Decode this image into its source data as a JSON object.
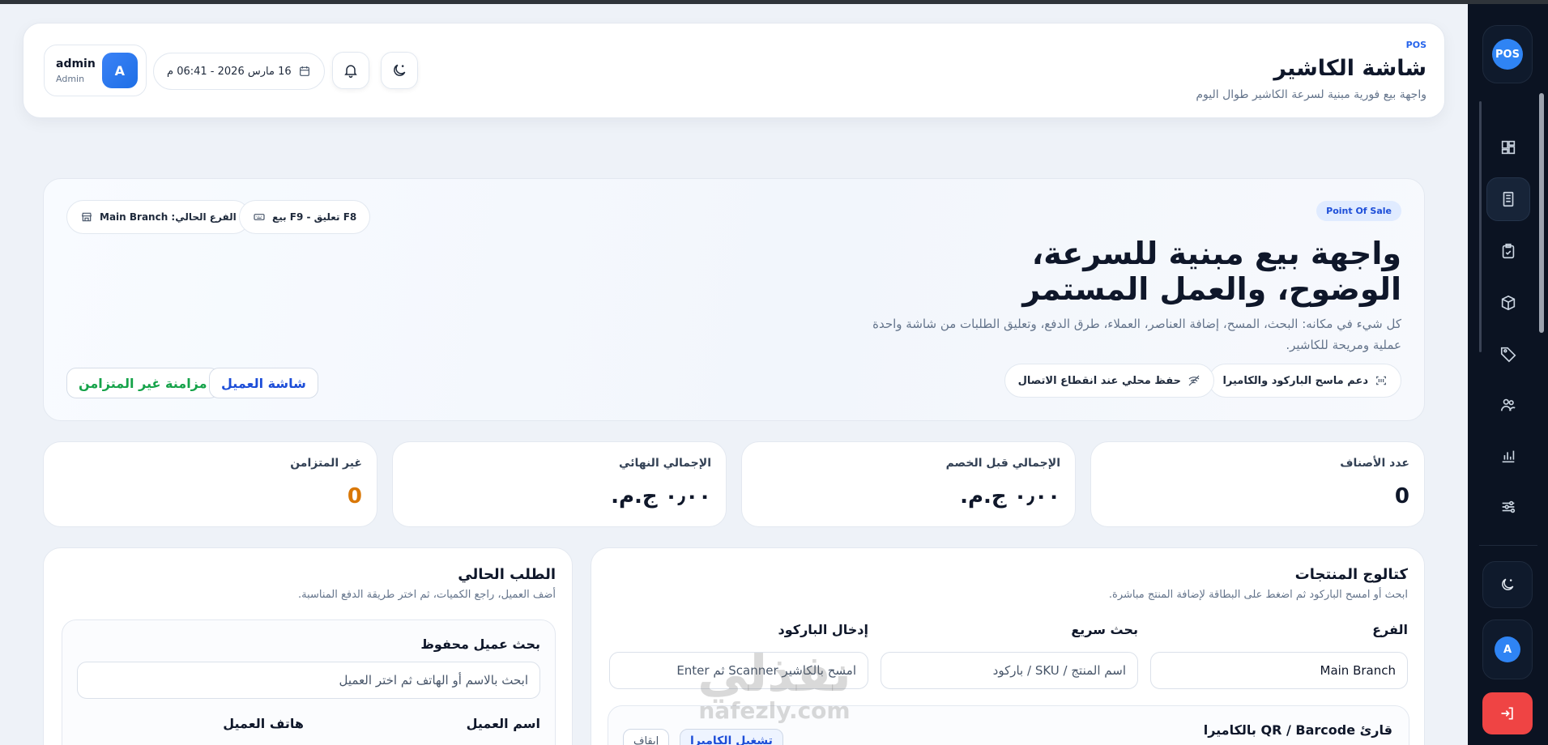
{
  "header": {
    "tag": "POS",
    "title": "شاشة الكاشير",
    "subtitle": "واجهة بيع فورية مبنية لسرعة الكاشير طوال اليوم",
    "datetime": "16 مارس 2026 - 06:41 م",
    "user_name": "admin",
    "user_role": "Admin",
    "user_initial": "A"
  },
  "hero": {
    "badge": "Point Of Sale",
    "title": "واجهة بيع مبنية للسرعة، الوضوح، والعمل المستمر",
    "description": "كل شيء في مكانه: البحث، المسح، إضافة العناصر، العملاء، طرق الدفع، وتعليق الطلبات من شاشة واحدة عملية ومريحة للكاشير.",
    "chip_branch": "الفرع الحالي: Main Branch",
    "chip_shortcuts": "F8 تعليق - F9 بيع",
    "feature_scanner": "دعم ماسح الباركود والكاميرا",
    "feature_offline": "حفظ محلي عند انقطاع الاتصال",
    "btn_customer_screen": "شاشة العميل",
    "btn_sync": "مزامنة غير المتزامن"
  },
  "stats": [
    {
      "label": "عدد الأصناف",
      "value": "0"
    },
    {
      "label": "الإجمالي قبل الخصم",
      "value": "٠٫٠٠ ج.م."
    },
    {
      "label": "الإجمالي النهائي",
      "value": "٠٫٠٠ ج.م."
    },
    {
      "label": "غير المتزامن",
      "value": "0"
    }
  ],
  "catalog": {
    "title": "كتالوج المنتجات",
    "subtitle": "ابحث أو امسح الباركود ثم اضغط على البطاقة لإضافة المنتج مباشرة.",
    "branch_label": "الفرع",
    "branch_value": "Main Branch",
    "quick_label": "بحث سريع",
    "quick_placeholder": "اسم المنتج / SKU / باركود",
    "barcode_label": "إدخال الباركود",
    "barcode_placeholder": "امسح بالكاشير Scanner ثم Enter",
    "camera_title": "قارئ QR / Barcode بالكاميرا",
    "camera_start": "تشغيل الكاميرا",
    "camera_stop": "إيقاف"
  },
  "order": {
    "title": "الطلب الحالي",
    "subtitle": "أضف العميل، راجع الكميات، ثم اختر طريقة الدفع المناسبة.",
    "search_label": "بحث عميل محفوظ",
    "search_placeholder": "ابحث بالاسم أو الهاتف ثم اختر العميل",
    "name_label": "اسم العميل",
    "phone_label": "هاتف العميل"
  },
  "rail": {
    "logo": "POS",
    "avatar": "A"
  },
  "watermark": {
    "line1": "نفذلي",
    "line2": "nafezly.com"
  },
  "colors": {
    "accent": "#2563eb",
    "sync_green": "#16a34a",
    "warning_orange": "#d97706",
    "rail_bg": "#0b1322",
    "logout_red": "#ef4444"
  }
}
